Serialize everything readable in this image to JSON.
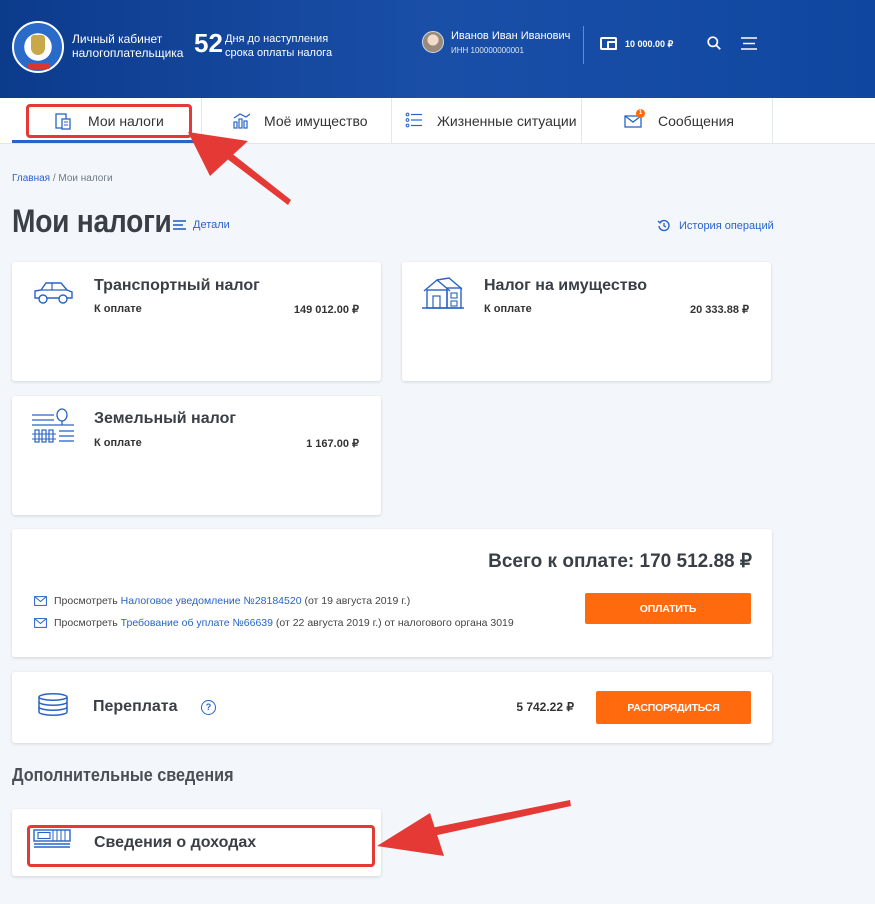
{
  "header": {
    "cabinet_title": "Личный кабинет налогоплательщика",
    "days_count": "52",
    "days_text": "Дня до наступления срока оплаты налога",
    "user_name": "Иванов Иван Иванович",
    "user_inn": "ИНН 100000000001",
    "balance": "10 000.00 ₽"
  },
  "tabs": [
    {
      "label": "Мои налоги",
      "icon": "calculator-doc-icon",
      "active": true
    },
    {
      "label": "Моё имущество",
      "icon": "property-chart-icon"
    },
    {
      "label": "Жизненные ситуации",
      "icon": "list-icon"
    },
    {
      "label": "Сообщения",
      "icon": "envelope-icon",
      "badge": "1"
    }
  ],
  "breadcrumb": {
    "home": "Главная",
    "separator": " / ",
    "current": "Мои налоги"
  },
  "page": {
    "title": "Мои налоги",
    "details_link": "Детали",
    "history_link": "История операций"
  },
  "tax_cards": [
    {
      "title": "Транспортный налог",
      "pay_label": "К оплате",
      "amount": "149 012.00 ₽",
      "icon": "car-icon"
    },
    {
      "title": "Налог на имущество",
      "pay_label": "К оплате",
      "amount": "20 333.88 ₽",
      "icon": "house-icon"
    },
    {
      "title": "Земельный налог",
      "pay_label": "К оплате",
      "amount": "1 167.00 ₽",
      "icon": "land-tree-icon"
    }
  ],
  "summary": {
    "total_text": "Всего к оплате: 170 512.88  ₽",
    "notice1_prefix": "Просмотреть",
    "notice1_link": "Налоговое уведомление №28184520",
    "notice1_suffix": "(от 19 августа 2019 г.)",
    "notice2_prefix": "Просмотреть",
    "notice2_link": "Требование об уплате №66639",
    "notice2_suffix": " (от 22 августа 2019 г.) от налогового органа 3019",
    "pay_button": "ОПЛАТИТЬ"
  },
  "overpayment": {
    "title": "Переплата",
    "help": "?",
    "amount": "5 742.22 ₽",
    "button": "РАСПОРЯДИТЬСЯ"
  },
  "additional": {
    "section_title": "Дополнительные сведения",
    "income_title": "Сведения о доходах"
  },
  "colors": {
    "header_blue": "#1a4fa8",
    "accent_blue": "#2863c7",
    "orange": "#ff6a0e",
    "annotation_red": "#e53935"
  }
}
